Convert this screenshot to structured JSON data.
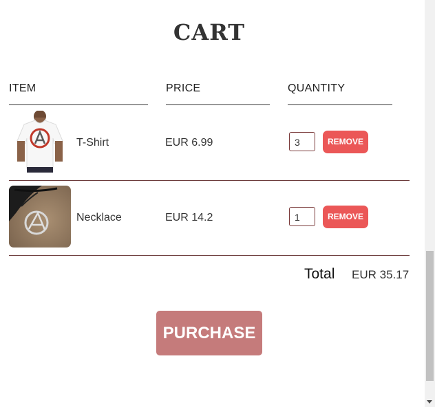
{
  "header": {
    "title": "CART"
  },
  "columns": {
    "item": "ITEM",
    "price": "PRICE",
    "quantity": "QUANTITY"
  },
  "items": [
    {
      "name": "T-Shirt",
      "price": "EUR 6.99",
      "quantity": "3",
      "remove_label": "REMOVE",
      "image_icon": "tshirt-image"
    },
    {
      "name": "Necklace",
      "price": "EUR 14.2",
      "quantity": "1",
      "remove_label": "REMOVE",
      "image_icon": "necklace-image"
    }
  ],
  "total": {
    "label": "Total",
    "value": "EUR 35.17"
  },
  "purchase": {
    "label": "PURCHASE"
  },
  "colors": {
    "remove_button": "#eb5757",
    "purchase_button": "#c57b7b",
    "row_divider": "#6b3a3a"
  }
}
